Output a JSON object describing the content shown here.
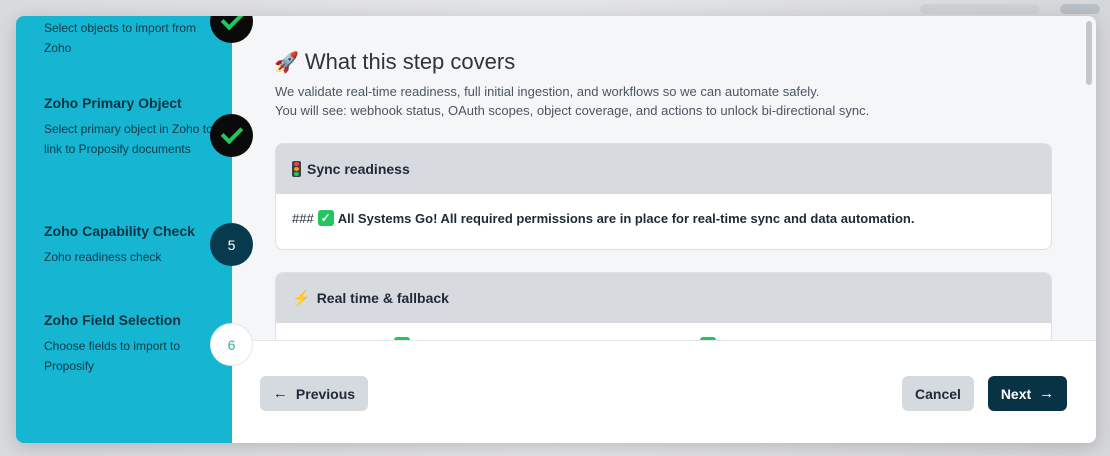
{
  "steps": [
    {
      "title": "",
      "desc": "Select objects to import from Zoho",
      "state": "done"
    },
    {
      "title": "Zoho Primary Object",
      "desc": "Select primary object in Zoho to link to Proposify documents",
      "state": "done"
    },
    {
      "title": "Zoho Capability Check",
      "desc": "Zoho readiness check",
      "state": "current",
      "number": "5"
    },
    {
      "title": "Zoho Field Selection",
      "desc": "Choose fields to import to Proposify",
      "state": "upcoming",
      "number": "6"
    }
  ],
  "main": {
    "heading": "What this step covers",
    "intro_line1": "We validate real-time readiness, full initial ingestion, and workflows so we can automate safely.",
    "intro_line2": "You will see: webhook status, OAuth scopes, object coverage, and actions to unlock bi-directional sync.",
    "cards": [
      {
        "title": "Sync readiness",
        "body_prefix": "###",
        "body": "All Systems Go! All required permissions are in place for real-time sync and data automation."
      },
      {
        "title": "Real time & fallback"
      }
    ]
  },
  "footer": {
    "previous_label": "Previous",
    "cancel_label": "Cancel",
    "next_label": "Next"
  },
  "colors": {
    "sidebar": "#16b5d1",
    "primary": "#083344",
    "success": "#22c55e"
  }
}
